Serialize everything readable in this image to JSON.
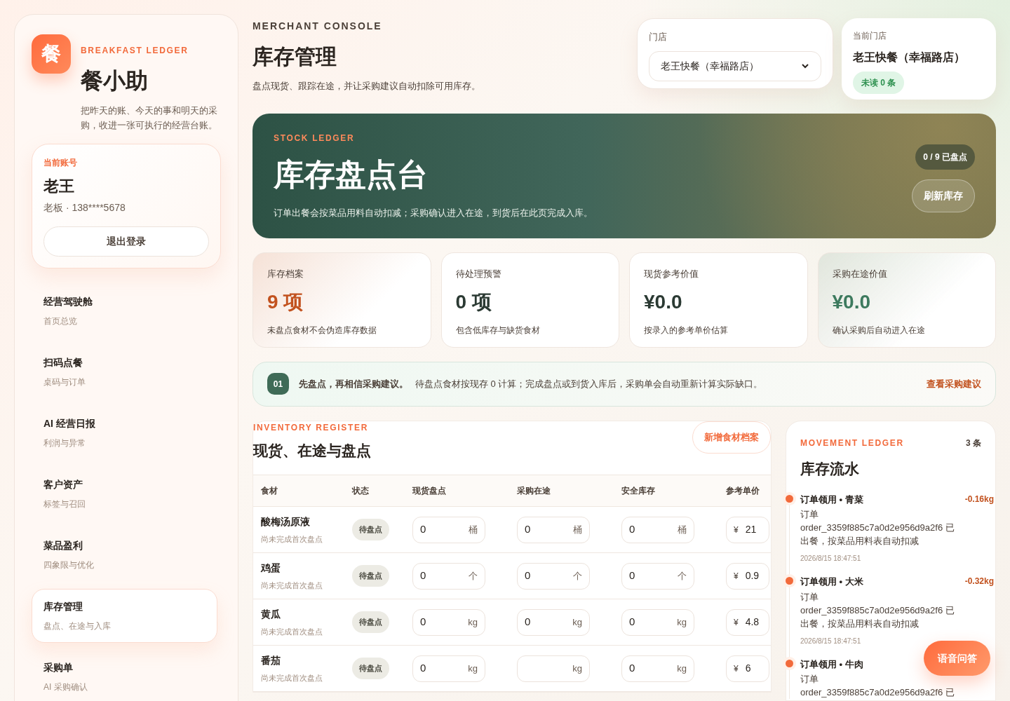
{
  "brand": {
    "logo": "餐",
    "eyebrow": "BREAKFAST LEDGER",
    "name": "餐小助",
    "tagline": "把昨天的账、今天的事和明天的采购，收进一张可执行的经营台账。"
  },
  "account": {
    "label": "当前账号",
    "name": "老王",
    "meta": "老板 · 138****5678",
    "logout": "退出登录"
  },
  "nav": [
    {
      "title": "经营驾驶舱",
      "subtitle": "首页总览",
      "selected": false
    },
    {
      "title": "扫码点餐",
      "subtitle": "桌码与订单",
      "selected": false
    },
    {
      "title": "AI 经营日报",
      "subtitle": "利润与异常",
      "selected": false
    },
    {
      "title": "客户资产",
      "subtitle": "标签与召回",
      "selected": false
    },
    {
      "title": "菜品盈利",
      "subtitle": "四象限与优化",
      "selected": false
    },
    {
      "title": "库存管理",
      "subtitle": "盘点、在途与入库",
      "selected": true
    },
    {
      "title": "采购单",
      "subtitle": "AI 采购确认",
      "selected": false
    }
  ],
  "header": {
    "eyebrow": "MERCHANT CONSOLE",
    "title": "库存管理",
    "subtitle": "盘点现货、跟踪在途，并让采购建议自动扣除可用库存。"
  },
  "store_picker": {
    "label": "门店",
    "value": "老王快餐（幸福路店）"
  },
  "current_store": {
    "label": "当前门店",
    "name": "老王快餐（幸福路店）",
    "badge": "未读 0 条"
  },
  "hero": {
    "eyebrow": "STOCK LEDGER",
    "title": "库存盘点台",
    "description": "订单出餐会按菜品用料自动扣减；采购确认进入在途，到货后在此页完成入库。",
    "progress": "0 / 9 已盘点",
    "button": "刷新库存"
  },
  "stats": [
    {
      "label": "库存档案",
      "value": "9 项",
      "note": "未盘点食材不会伪造库存数据",
      "color": "#c2521f",
      "highlighted": true
    },
    {
      "label": "待处理预警",
      "value": "0 项",
      "note": "包含低库存与缺货食材",
      "color": "#2b3a33",
      "highlighted": false
    },
    {
      "label": "现货参考价值",
      "value": "¥0.0",
      "note": "按录入的参考单价估算",
      "color": "#2b3a33",
      "highlighted": false
    },
    {
      "label": "采购在途价值",
      "value": "¥0.0",
      "note": "确认采购后自动进入在途",
      "color": "#3d7a5e",
      "highlighted": true
    }
  ],
  "tip": {
    "step": "01",
    "headline": "先盘点，再相信采购建议。",
    "text": "待盘点食材按现存 0 计算；完成盘点或到货入库后，采购单会自动重新计算实际缺口。",
    "link": "查看采购建议"
  },
  "register": {
    "eyebrow": "INVENTORY REGISTER",
    "title": "现货、在途与盘点",
    "button": "新增食材档案",
    "columns": [
      "食材",
      "状态",
      "现货盘点",
      "采购在途",
      "安全库存",
      "参考单价"
    ],
    "rows": [
      {
        "name": "酸梅汤原液",
        "note": "尚未完成首次盘点",
        "status": "待盘点",
        "on_hand": {
          "value": "0",
          "unit": "桶"
        },
        "in_transit": {
          "value": "0",
          "unit": "桶"
        },
        "safety": {
          "value": "0",
          "unit": "桶"
        },
        "price": {
          "currency": "¥",
          "value": "21"
        }
      },
      {
        "name": "鸡蛋",
        "note": "尚未完成首次盘点",
        "status": "待盘点",
        "on_hand": {
          "value": "0",
          "unit": "个"
        },
        "in_transit": {
          "value": "0",
          "unit": "个"
        },
        "safety": {
          "value": "0",
          "unit": "个"
        },
        "price": {
          "currency": "¥",
          "value": "0.9"
        }
      },
      {
        "name": "黄瓜",
        "note": "尚未完成首次盘点",
        "status": "待盘点",
        "on_hand": {
          "value": "0",
          "unit": "kg"
        },
        "in_transit": {
          "value": "0",
          "unit": "kg"
        },
        "safety": {
          "value": "0",
          "unit": "kg"
        },
        "price": {
          "currency": "¥",
          "value": "4.8"
        }
      },
      {
        "name": "番茄",
        "note": "尚未完成首次盘点",
        "status": "待盘点",
        "on_hand": {
          "value": "0",
          "unit": "kg"
        },
        "in_transit": {
          "unit": "kg"
        },
        "safety": {
          "value": "0",
          "unit": "kg"
        },
        "price": {
          "currency": "¥",
          "value": "6"
        }
      }
    ]
  },
  "movements": {
    "eyebrow": "MOVEMENT LEDGER",
    "count": "3 条",
    "title": "库存流水",
    "items": [
      {
        "title": "订单领用 • 青菜",
        "amount": "-0.16kg",
        "description": "订单 order_3359f885c7a0d2e956d9a2f6 已出餐，按菜品用料表自动扣减",
        "time": "2026/8/15 18:47:51"
      },
      {
        "title": "订单领用 • 大米",
        "amount": "-0.32kg",
        "description": "订单 order_3359f885c7a0d2e956d9a2f6 已出餐，按菜品用料表自动扣减",
        "time": "2026/8/15 18:47:51"
      },
      {
        "title": "订单领用 • 牛肉",
        "description": "订单 order_3359f885c7a0d2e956d9a2f6 已"
      }
    ]
  },
  "voice_button": "语音问答"
}
